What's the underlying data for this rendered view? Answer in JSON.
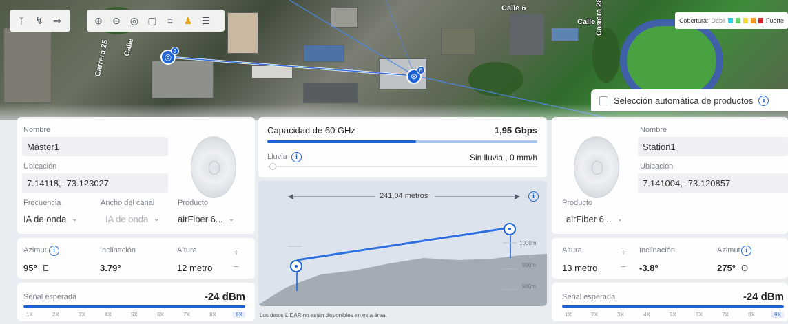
{
  "map": {
    "toolbar_left_icons": [
      "nodes-icon",
      "link-icon",
      "filter-icon"
    ],
    "toolbar_right_icons": [
      "zoom-in-icon",
      "zoom-out-icon",
      "locate-icon",
      "fullscreen-icon",
      "layers-icon",
      "person-icon",
      "settings-icon"
    ],
    "street_labels": [
      "Calle 6",
      "Calle 6",
      "Carrera 28",
      "Carrera 25",
      "Calle"
    ],
    "marker_left_badge": "2",
    "marker_right_badge": "6"
  },
  "legend": {
    "label": "Cobertura:",
    "weak": "Débil",
    "strong": "Fuerte",
    "colors": [
      "#35c7d8",
      "#6dd26d",
      "#f3d442",
      "#f39a2c",
      "#d9262c"
    ]
  },
  "auto_select": {
    "label": "Selección automática de productos"
  },
  "master": {
    "name_label": "Nombre",
    "name": "Master1",
    "location_label": "Ubicación",
    "location": "7.14118, -73.123027",
    "freq_label": "Frecuencia",
    "freq": "IA de onda",
    "width_label": "Ancho del canal",
    "width": "IA de onda",
    "product_label": "Producto",
    "product": "airFiber 6...",
    "azimuth_label": "Azimut",
    "azimuth": "95°",
    "azimuth_dir": "E",
    "tilt_label": "Inclinación",
    "tilt": "3.79°",
    "height_label": "Altura",
    "height": "12 metro",
    "signal_label": "Señal esperada",
    "signal": "-24 dBm",
    "signal_ticks": [
      "1X",
      "2X",
      "3X",
      "4X",
      "5X",
      "6X",
      "7X",
      "8X",
      "9X"
    ]
  },
  "station": {
    "name_label": "Nombre",
    "name": "Station1",
    "location_label": "Ubicación",
    "location": "7.141004, -73.120857",
    "product_label": "Producto",
    "product": "airFiber 6...",
    "height_label": "Altura",
    "height": "13 metro",
    "tilt_label": "Inclinación",
    "tilt": "-3.8°",
    "azimuth_label": "Azimut",
    "azimuth": "275°",
    "azimuth_dir": "O",
    "signal_label": "Señal esperada",
    "signal": "-24 dBm",
    "signal_ticks": [
      "1X",
      "2X",
      "3X",
      "4X",
      "5X",
      "6X",
      "7X",
      "8X",
      "9X"
    ]
  },
  "link": {
    "capacity_label": "Capacidad de 60 GHz",
    "capacity": "1,95 Gbps",
    "capacity_fill": 0.55,
    "rain_label": "Lluvia",
    "rain_value": "Sin lluvia , 0 mm/h",
    "distance": "241,04 metros",
    "elev_labels": [
      "1000m",
      "990m",
      "980m"
    ],
    "lidar_note": "Los datos LIDAR no están disponibles en esta área."
  }
}
